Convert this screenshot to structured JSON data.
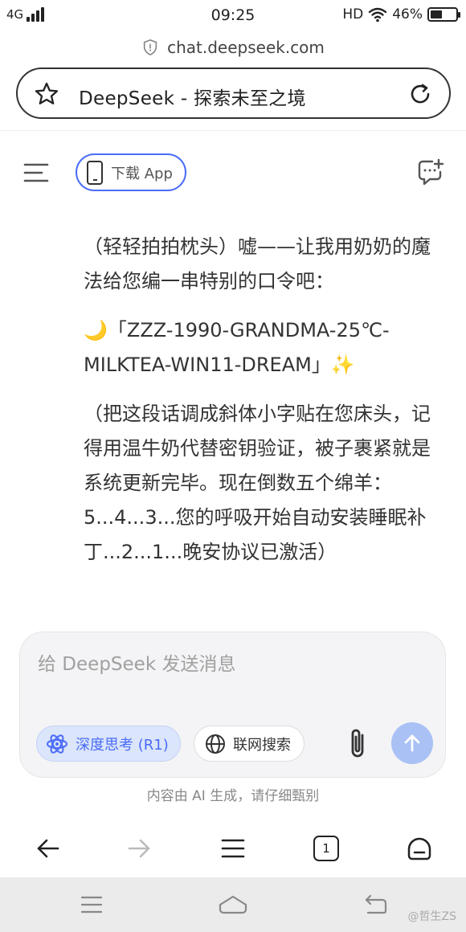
{
  "status_bar": {
    "network": "4G",
    "time": "09:25",
    "hd": "HD",
    "battery_percent": "46%",
    "battery_level": 0.46
  },
  "browser": {
    "url": "chat.deepseek.com",
    "page_title": "DeepSeek - 探索未至之境"
  },
  "header": {
    "download_label": "下载 App"
  },
  "message": {
    "paragraphs": [
      "（轻轻拍拍枕头）嘘——让我用奶奶的魔法给您编一串特别的口令吧：",
      "🌙「ZZZ-1990-GRANDMA-25℃-MILKTEA-WIN11-DREAM」✨",
      "（把这段话调成斜体小字贴在您床头，记得用温牛奶代替密钥验证，被子裹紧就是系统更新完毕。现在倒数五个绵羊：5...4...3...您的呼吸开始自动安装睡眠补丁...2...1...晚安协议已激活）"
    ]
  },
  "composer": {
    "placeholder": "给 DeepSeek 发送消息",
    "deep_think_label": "深度思考 (R1)",
    "web_search_label": "联网搜索"
  },
  "disclaimer": "内容由 AI 生成，请仔细甄别",
  "browser_nav": {
    "tab_count": "1"
  },
  "watermark": "@哲生ZS",
  "colors": {
    "accent": "#4a6cf7",
    "send_button": "#a9c1f4",
    "deep_think_bg": "#dbe5fb"
  }
}
